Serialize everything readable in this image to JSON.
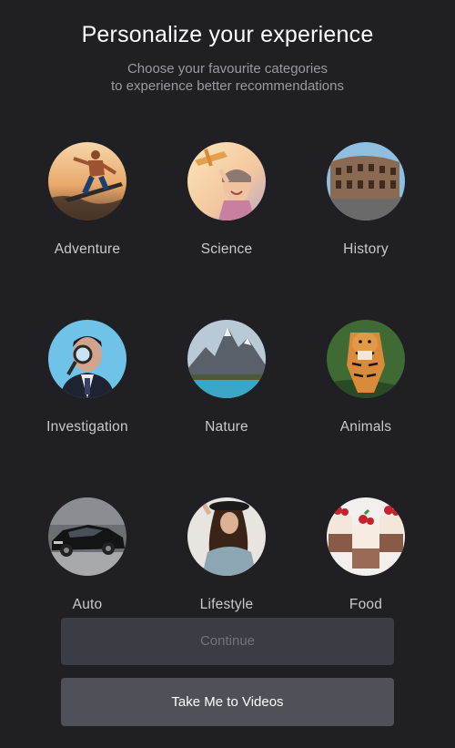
{
  "header": {
    "title": "Personalize your experience",
    "subtitle_line1": "Choose your favourite categories",
    "subtitle_line2": "to experience better recommendations"
  },
  "categories": [
    {
      "label": "Adventure",
      "icon": "surfer-photo"
    },
    {
      "label": "Science",
      "icon": "girl-with-plane-photo"
    },
    {
      "label": "History",
      "icon": "colosseum-photo"
    },
    {
      "label": "Investigation",
      "icon": "detective-magnifier-photo"
    },
    {
      "label": "Nature",
      "icon": "mountain-lake-photo"
    },
    {
      "label": "Animals",
      "icon": "tiger-photo"
    },
    {
      "label": "Auto",
      "icon": "black-car-photo"
    },
    {
      "label": "Lifestyle",
      "icon": "woman-with-hat-photo"
    },
    {
      "label": "Food",
      "icon": "desserts-photo"
    }
  ],
  "buttons": {
    "continue_label": "Continue",
    "videos_label": "Take Me to Videos"
  },
  "colors": {
    "background": "#1f1f24",
    "continue_bg": "#3a3d43",
    "videos_bg": "#4e5157"
  }
}
